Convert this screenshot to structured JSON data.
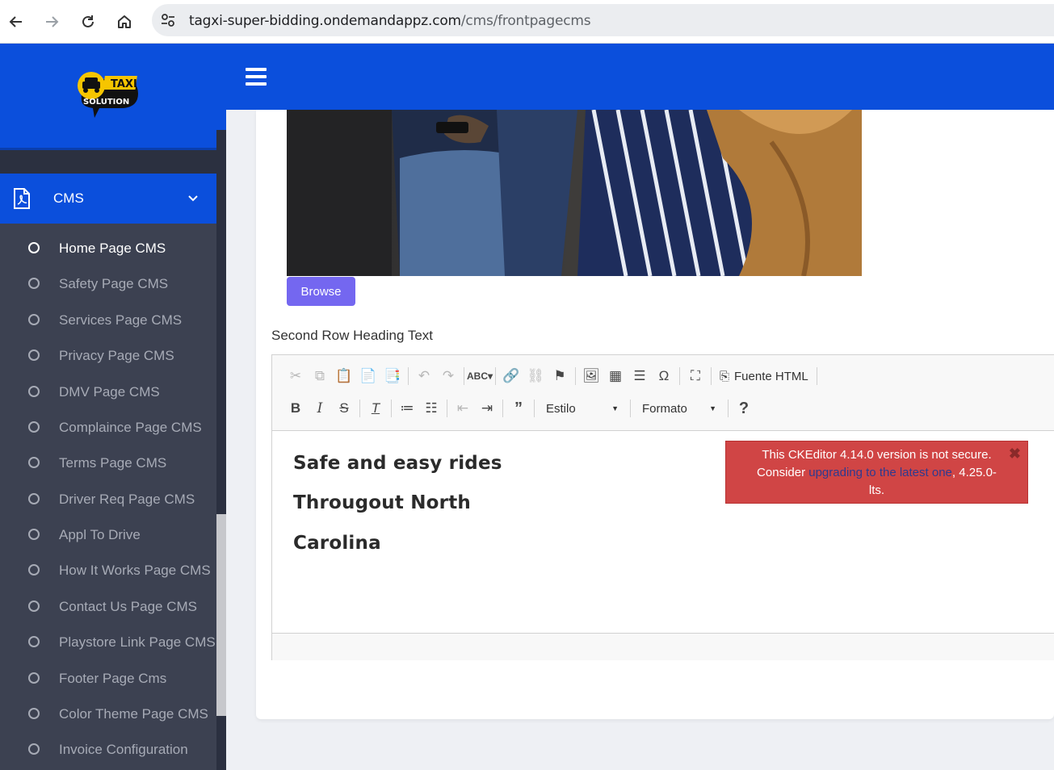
{
  "browser": {
    "url_host": "tagxi-super-bidding.ondemandappz.com",
    "url_path": "/cms/frontpagecms"
  },
  "logo": {
    "line1": "TAXI",
    "line2": "SOLUTION"
  },
  "sidebar": {
    "section_label": "CMS",
    "items": [
      {
        "label": "Home Page CMS",
        "active": true
      },
      {
        "label": "Safety Page CMS"
      },
      {
        "label": "Services Page CMS"
      },
      {
        "label": "Privacy Page CMS"
      },
      {
        "label": "DMV Page CMS"
      },
      {
        "label": "Complaince Page CMS"
      },
      {
        "label": "Terms Page CMS"
      },
      {
        "label": "Driver Req Page CMS"
      },
      {
        "label": "Appl To Drive"
      },
      {
        "label": "How It Works Page CMS"
      },
      {
        "label": "Contact Us Page CMS"
      },
      {
        "label": "Playstore Link Page CMS"
      },
      {
        "label": "Footer Page Cms"
      },
      {
        "label": "Color Theme Page CMS"
      },
      {
        "label": "Invoice Configuration"
      }
    ]
  },
  "main": {
    "browse_label": "Browse",
    "field_label": "Second Row Heading Text"
  },
  "editor": {
    "source_label": "Fuente HTML",
    "style_combo": "Estilo",
    "format_combo": "Formato",
    "content": [
      "Safe and easy rides",
      "Througout North",
      "Carolina"
    ]
  },
  "warning": {
    "line1": "This CKEditor 4.14.0 version is not secure.",
    "line2_pre": "Consider ",
    "line2_link": "upgrading to the latest one",
    "line2_post": ", 4.25.0-",
    "line3": "lts."
  },
  "colors": {
    "brand_blue": "#0b4fdc",
    "sidebar_dark": "#3c4151",
    "browse_purple": "#7467f0",
    "warning_red": "#d04545"
  }
}
